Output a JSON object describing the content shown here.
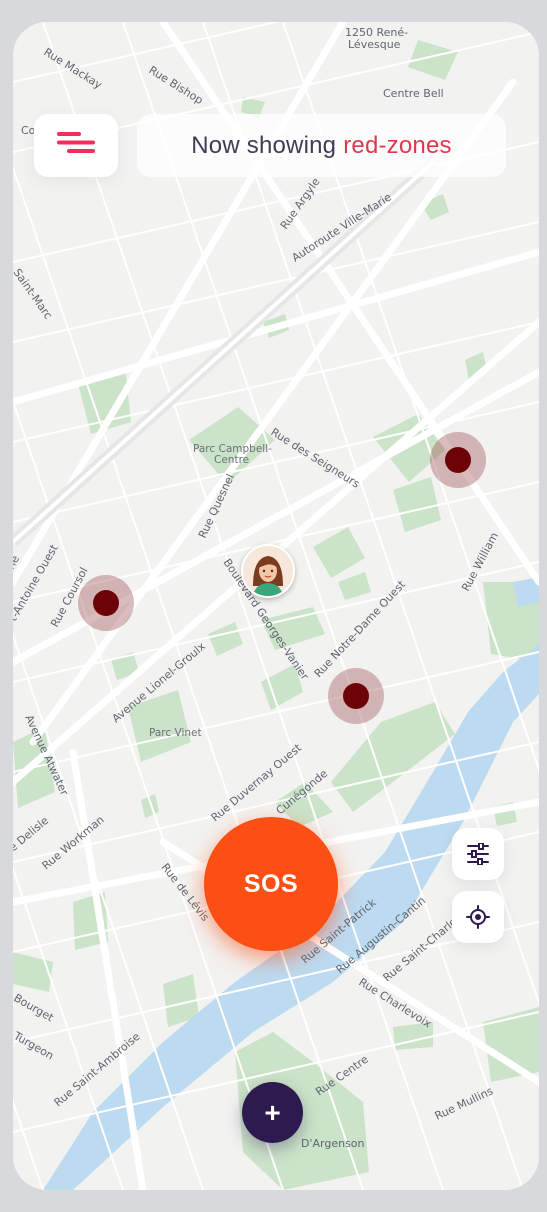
{
  "header": {
    "status_prefix": "Now showing",
    "status_highlight": "red-zones"
  },
  "map": {
    "street_labels": [
      "1250 René-",
      "Lévesque",
      "Rue Mackay",
      "Rue Bishop",
      "Centre Bell",
      "Co",
      "Rue Argyle",
      "Autoroute Ville-Marie",
      "Saint-Marc",
      "Rue des Seigneurs",
      "Rue Quesnel",
      "ne",
      "t-Antoine Ouest",
      "Rue Coursol",
      "Boulevard Georges-Vanier",
      "Rue Notre-Dame Ouest",
      "Rue William",
      "Avenue Lionel-Groulx",
      "Avenue Atwater",
      "Rue Duvernay Ouest",
      "Cunégonde",
      "e Delisle",
      "Rue Workman",
      "Rue de Lévis",
      "Rue Saint-Patrick",
      "Rue Augustin-Cantin",
      "Rue Saint-Charles",
      "Rue Charlevoix",
      "Bourget",
      "Turgeon",
      "Rue Saint-Ambroise",
      "Rue Centre",
      "Rue Mullins",
      "D'Argenson"
    ],
    "park_labels": [
      "Parc Campbell-",
      "Centre",
      "Parc Vinet"
    ]
  },
  "buttons": {
    "sos_label": "SOS",
    "add_label": "+"
  },
  "icons": {
    "menu": "menu-icon",
    "filter": "sliders-icon",
    "locate": "crosshair-icon"
  },
  "colors": {
    "accent": "#e0384f",
    "sos": "#fb4f14",
    "add": "#2d1a4f",
    "zone_core": "#6c0306",
    "water": "#bcdaf0",
    "park": "#cbe3c8"
  }
}
